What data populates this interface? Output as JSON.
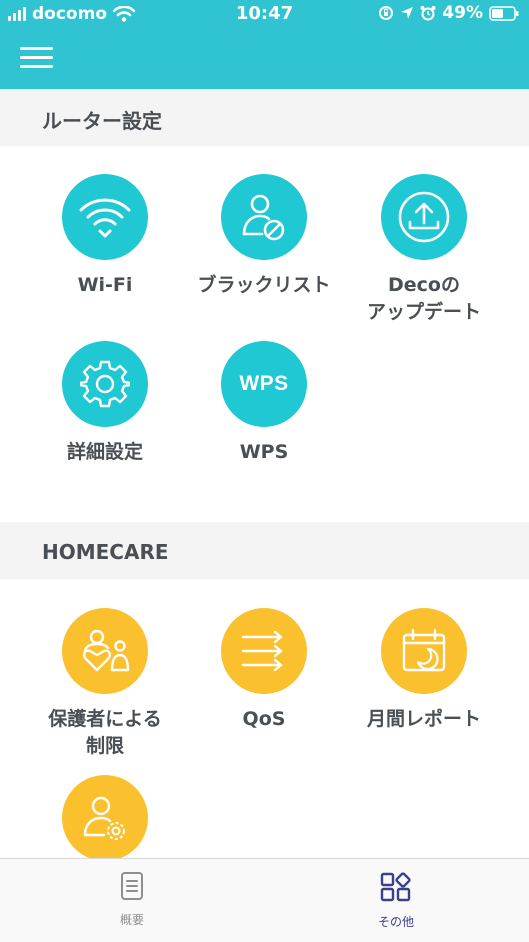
{
  "status_bar": {
    "carrier": "docomo",
    "time": "10:47",
    "battery": "49%"
  },
  "header": {
    "menu_icon": "hamburger-menu-icon"
  },
  "sections": {
    "router": {
      "title": "ルーター設定",
      "tiles": {
        "wifi": {
          "label": "Wi-Fi",
          "icon": "wifi-icon"
        },
        "blacklist": {
          "label": "ブラックリスト",
          "icon": "user-blocked-icon"
        },
        "update": {
          "label_line1": "Decoの",
          "label_line2": "アップデート",
          "icon": "upload-icon"
        },
        "advanced": {
          "label": "詳細設定",
          "icon": "gear-icon"
        },
        "wps": {
          "label": "WPS",
          "icon_text": "WPS"
        }
      }
    },
    "homecare": {
      "title": "HOMECARE",
      "tiles": {
        "parental": {
          "label_line1": "保護者による",
          "label_line2": "制限",
          "icon": "family-heart-icon"
        },
        "qos": {
          "label": "QoS",
          "icon": "arrows-icon"
        },
        "monthly": {
          "label": "月間レポート",
          "icon": "calendar-moon-icon"
        },
        "profile": {
          "icon": "user-gear-icon"
        }
      }
    }
  },
  "tabbar": {
    "overview": {
      "label": "概要",
      "icon": "document-icon"
    },
    "more": {
      "label": "その他",
      "icon": "grid-icon"
    }
  },
  "colors": {
    "header": "#30c4d2",
    "teal_icon": "#20c8d3",
    "yellow_icon": "#fbc02d",
    "active_tab": "#3b3f8c"
  }
}
